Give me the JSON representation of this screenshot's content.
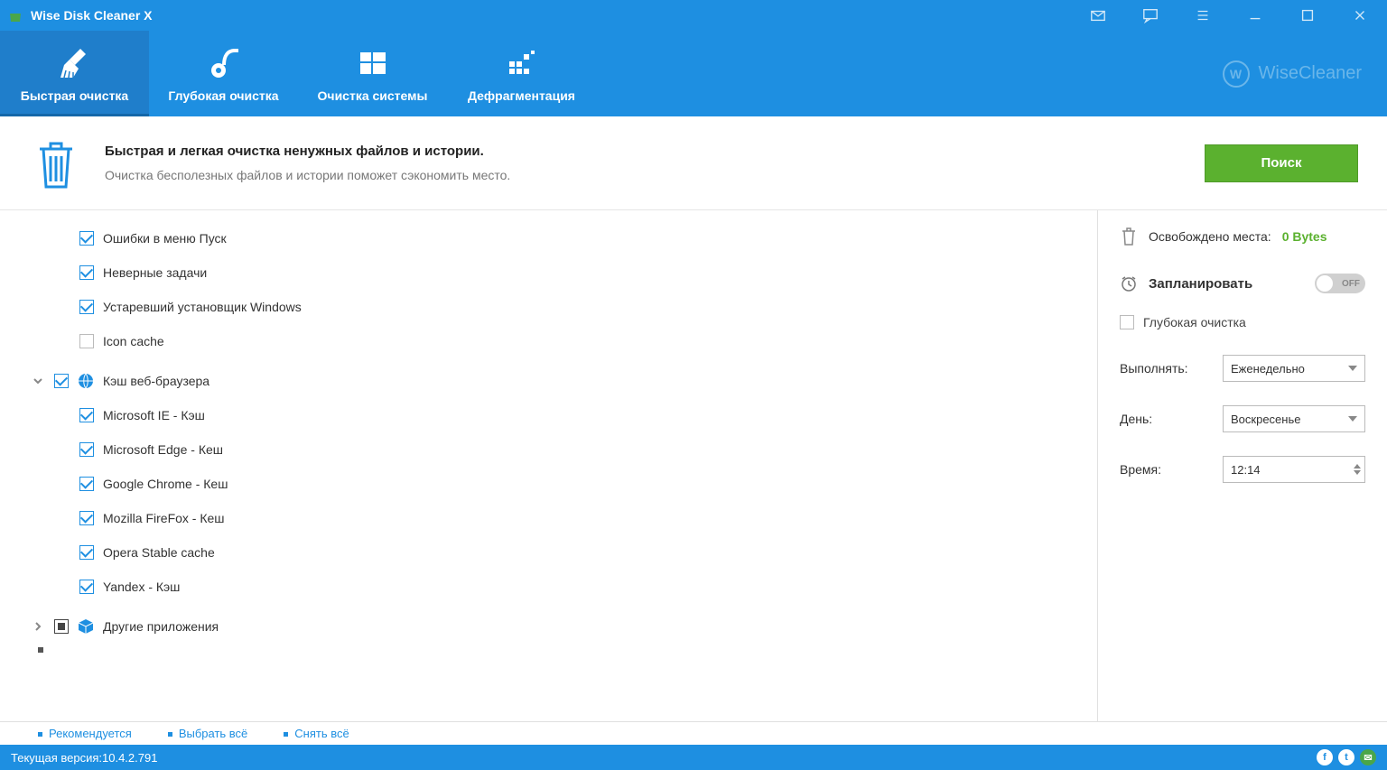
{
  "titlebar": {
    "title": "Wise Disk Cleaner X"
  },
  "tabs": {
    "quick": "Быстрая очистка",
    "deep": "Глубокая очистка",
    "system": "Очистка системы",
    "defrag": "Дефрагментация"
  },
  "brand": "WiseCleaner",
  "banner": {
    "heading": "Быстрая и легкая очистка ненужных файлов и истории.",
    "sub": "Очистка бесполезных файлов и истории поможет сэкономить место.",
    "button": "Поиск"
  },
  "tree": {
    "items": [
      {
        "label": "Ошибки в меню Пуск",
        "checked": true
      },
      {
        "label": "Неверные задачи",
        "checked": true
      },
      {
        "label": "Устаревший установщик Windows",
        "checked": true
      },
      {
        "label": "Icon cache",
        "checked": false
      }
    ],
    "group_browser": {
      "label": "Кэш веб-браузера",
      "items": [
        {
          "label": "Microsoft IE - Кэш"
        },
        {
          "label": "Microsoft Edge - Кеш"
        },
        {
          "label": "Google Chrome - Кеш"
        },
        {
          "label": "Mozilla FireFox - Кеш"
        },
        {
          "label": "Opera Stable cache"
        },
        {
          "label": "Yandex - Кэш"
        }
      ]
    },
    "group_other": {
      "label": "Другие приложения"
    }
  },
  "side": {
    "freed_label": "Освобождено места:",
    "freed_value": "0 Bytes",
    "schedule_label": "Запланировать",
    "toggle_text": "OFF",
    "deep_label": "Глубокая очистка",
    "perform_label": "Выполнять:",
    "perform_value": "Еженедельно",
    "day_label": "День:",
    "day_value": "Воскресенье",
    "time_label": "Время:",
    "time_value": "12:14"
  },
  "footer": {
    "recommended": "Рекомендуется",
    "select_all": "Выбрать всё",
    "deselect_all": "Снять всё"
  },
  "status": {
    "version_label": "Текущая версия:",
    "version_value": "10.4.2.791"
  }
}
